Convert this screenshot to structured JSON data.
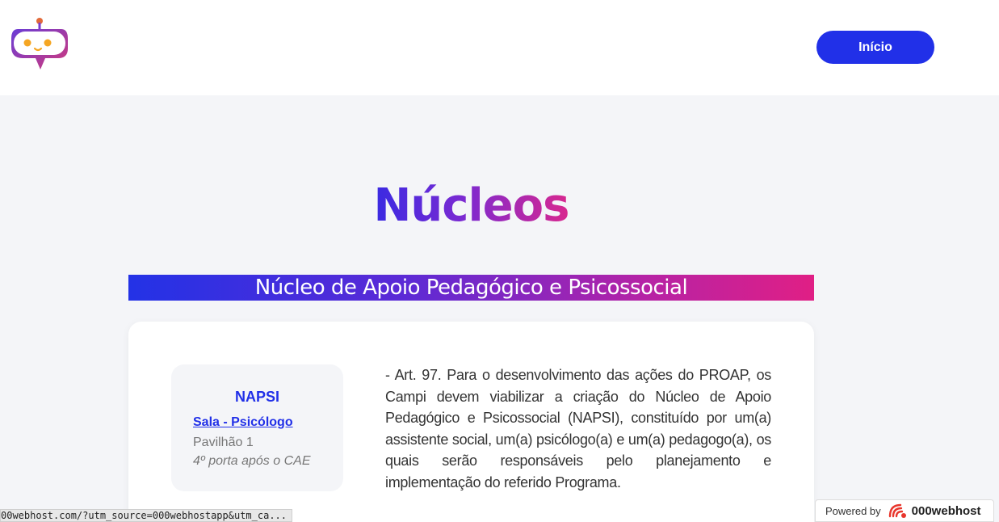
{
  "header": {
    "logo_name": "robot-chat-logo",
    "nav_button_label": "Início"
  },
  "main": {
    "title": "Núcleos",
    "section_title": "Núcleo de Apoio Pedagógico e Psicossocial",
    "card": {
      "box_title": "NAPSI",
      "box_link": "Sala - Psicólogo",
      "box_location": "Pavilhão 1",
      "box_note": "4º porta após o CAE",
      "article_text": "- Art. 97. Para o desenvolvimento das ações do PROAP, os Campi devem viabilizar a criação do Núcleo de Apoio Pedagógico e Psicossocial (NAPSI), constituído por um(a) assistente social, um(a) psicólogo(a) e um(a) pedagogo(a), os quais serão responsáveis pelo planejamento e implementação do referido Programa."
    }
  },
  "status_bar": {
    "url": "00webhost.com/?utm_source=000webhostapp&utm_ca..."
  },
  "powered_badge": {
    "label": "Powered by",
    "brand": "000webhost"
  },
  "colors": {
    "primary_blue": "#2130e8",
    "gradient_start": "#2332e6",
    "gradient_end": "#e01f85"
  }
}
